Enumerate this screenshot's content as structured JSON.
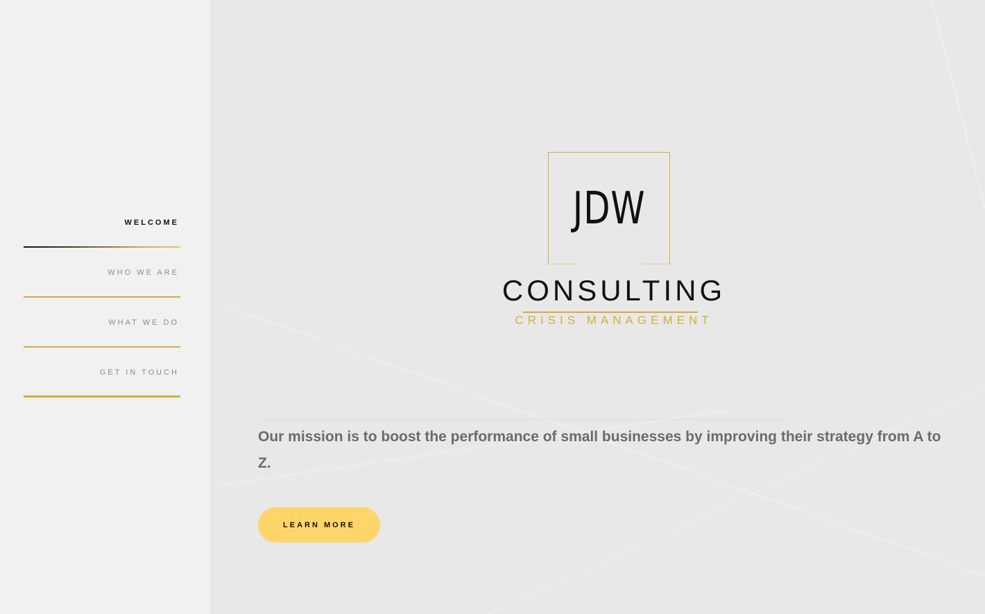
{
  "sidebar": {
    "items": [
      {
        "label": "WELCOME",
        "active": true
      },
      {
        "label": "WHO WE ARE",
        "active": false
      },
      {
        "label": "WHAT WE DO",
        "active": false
      },
      {
        "label": "GET IN TOUCH",
        "active": false
      }
    ]
  },
  "logo": {
    "initials": "JDW",
    "name": "CONSULTING",
    "tagline": "CRISIS MANAGEMENT"
  },
  "main": {
    "mission": "Our mission is to boost the performance of small businesses by improving their strategy from A to Z.",
    "cta_label": "LEARN MORE"
  },
  "colors": {
    "accent_gold": "#d4ad3c",
    "button_yellow": "#fdd569",
    "sidebar_bg": "#f1f1f1",
    "main_bg": "#e8e8e8",
    "text_dark": "#111111",
    "text_muted": "#6b6b6b"
  }
}
